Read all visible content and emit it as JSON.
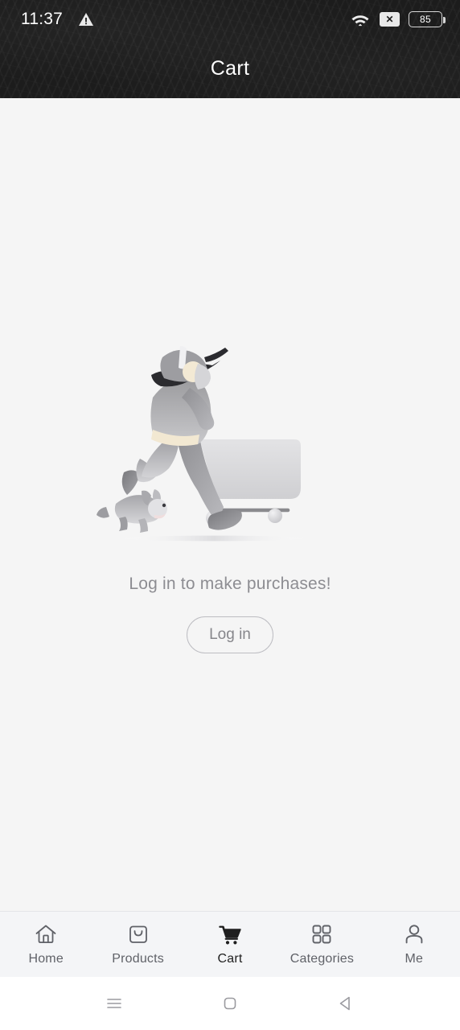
{
  "status_bar": {
    "time": "11:37",
    "warning_icon": "warning-triangle-icon",
    "wifi_icon": "wifi-icon",
    "no_data_label": "✕",
    "battery_level": "85"
  },
  "header": {
    "title": "Cart",
    "background_color": "#1c1c1c",
    "title_color": "#ffffff"
  },
  "main": {
    "illustration_name": "person-pushing-shopping-cart-with-dog-illustration",
    "empty_message": "Log in to make purchases!",
    "login_button_label": "Log in",
    "background_color": "#f5f5f5",
    "text_color": "#8d8d92",
    "button_border_color": "#bdbdc2"
  },
  "tabbar": {
    "background_color": "#f4f5f7",
    "active_color": "#1f1f1f",
    "inactive_color": "#606268",
    "items": [
      {
        "label": "Home",
        "icon": "home-icon",
        "active": false
      },
      {
        "label": "Products",
        "icon": "bag-icon",
        "active": false
      },
      {
        "label": "Cart",
        "icon": "cart-icon",
        "active": true
      },
      {
        "label": "Categories",
        "icon": "grid-icon",
        "active": false
      },
      {
        "label": "Me",
        "icon": "person-icon",
        "active": false
      }
    ]
  },
  "system_nav": {
    "recents": "menu-lines-icon",
    "home": "rounded-square-icon",
    "back": "triangle-left-icon"
  }
}
